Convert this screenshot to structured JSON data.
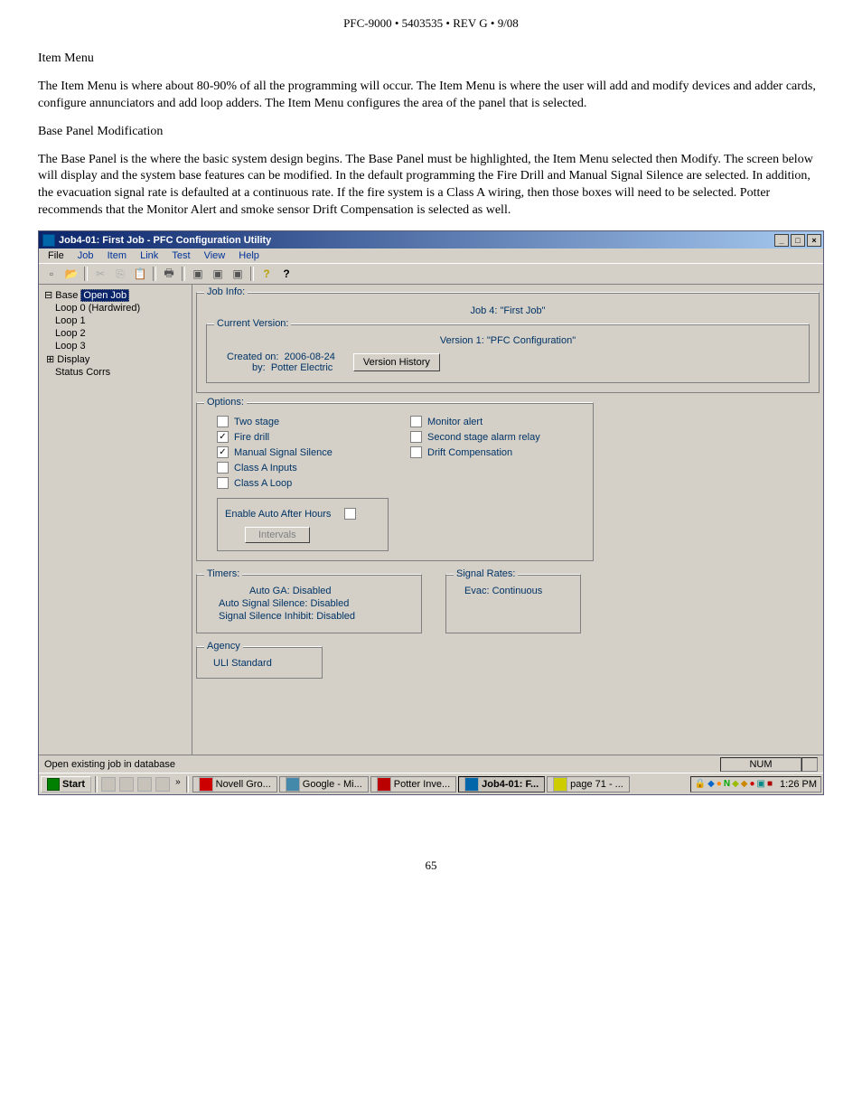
{
  "page_header": "PFC-9000 • 5403535 • REV G • 9/08",
  "doc": {
    "h_item_menu": "Item Menu",
    "p_item_menu": " The Item Menu is where about 80-90% of all the programming will occur. The Item Menu is where the user will add and modify devices and adder cards, configure annunciators and add loop adders. The Item Menu configures the area of the panel that is selected.",
    "h_base_panel": "Base Panel Modification",
    "p_base_panel": "The Base Panel is the where the basic system design begins. The Base Panel must be highlighted, the Item Menu selected then Modify. The screen below will display and the system base features can be modified. In the default programming the Fire Drill and Manual Signal Silence are selected. In addition, the evacuation signal rate is defaulted at a continuous rate. If the fire system is a Class A wiring, then those boxes will need to be selected. Potter recommends that the Monitor Alert and smoke sensor Drift Compensation is selected as well."
  },
  "app": {
    "title": "Job4-01: First Job - PFC Configuration Utility",
    "menu": {
      "file": "File",
      "job": "Job",
      "item": "Item",
      "link": "Link",
      "test": "Test",
      "view": "View",
      "help": "Help"
    },
    "tree": {
      "root_prefix": "Base ",
      "root_sel": "Open Job",
      "items": [
        "Loop 0  (Hardwired)",
        "Loop 1",
        "Loop 2",
        "Loop 3",
        "Display",
        "Status Corrs"
      ]
    },
    "job_info": {
      "label": "Job Info:",
      "job_line": "Job 4:  \"First Job\""
    },
    "current_version": {
      "label": "Current Version:",
      "version_line": "Version 1:  \"PFC Configuration\"",
      "created_label": "Created on:",
      "created_val": "2006-08-24",
      "by_label": "by:",
      "by_val": "Potter Electric",
      "history_btn": "Version History"
    },
    "options": {
      "label": "Options:",
      "left": [
        "Two stage",
        "Fire drill",
        "Manual Signal Silence",
        "Class A Inputs",
        "Class A Loop"
      ],
      "right": [
        "Monitor alert",
        "Second stage alarm relay",
        "Drift Compensation"
      ],
      "checked_left": [
        false,
        true,
        true,
        false,
        false
      ],
      "checked_right": [
        false,
        false,
        false
      ],
      "enable_auto": "Enable Auto After Hours",
      "intervals_btn": "Intervals"
    },
    "timers": {
      "label": "Timers:",
      "lines": [
        "Auto GA:  Disabled",
        "Auto Signal Silence:  Disabled",
        "Signal Silence Inhibit:  Disabled"
      ]
    },
    "signal_rates": {
      "label": "Signal Rates:",
      "line": "Evac:  Continuous"
    },
    "agency": {
      "label": "Agency",
      "value": "ULI Standard"
    },
    "status": {
      "text": "Open existing job in database",
      "num": "NUM"
    },
    "taskbar": {
      "start": "Start",
      "items": [
        "Novell Gro...",
        "Google - Mi...",
        "Potter Inve...",
        "Job4-01: F...",
        "page 71 - ..."
      ],
      "active_index": 3,
      "clock": "1:26 PM"
    }
  },
  "page_number": "65"
}
